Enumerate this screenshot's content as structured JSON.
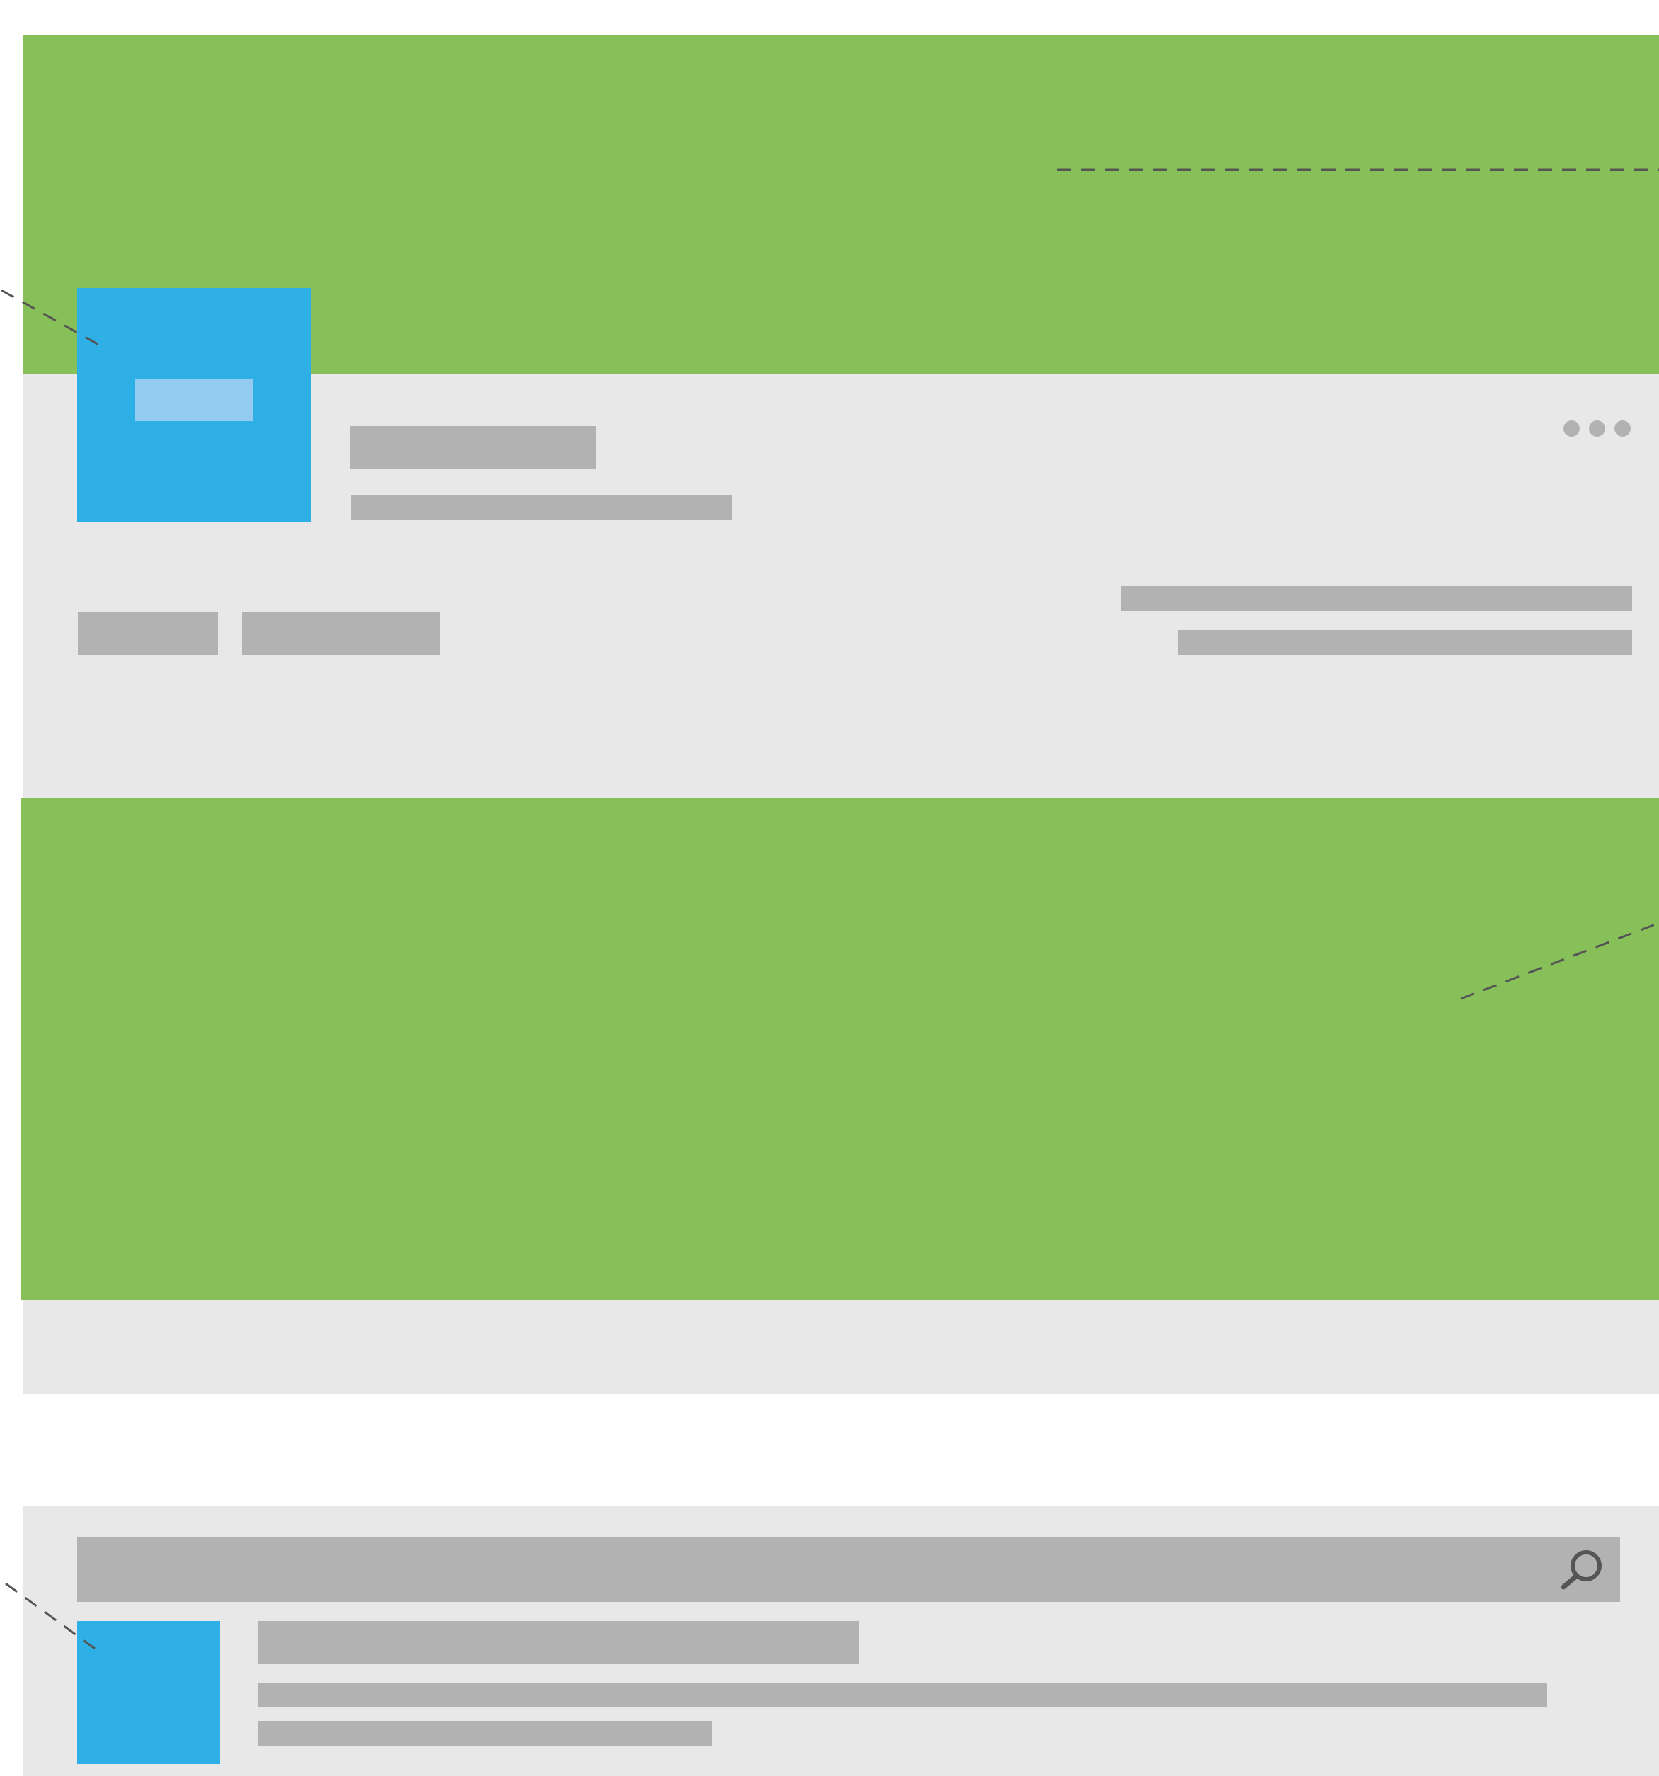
{
  "colors": {
    "background": "#ffffff",
    "panel": "#e7e8e7",
    "banner": "#87bf59",
    "tile": "#2eb0e6",
    "tile_label": "#93cbf1",
    "placeholder": "#b2b2b2",
    "callout_line": "#555555",
    "icon": "#555555"
  },
  "icons": {
    "more": "more-dots-icon",
    "search": "search-icon"
  }
}
